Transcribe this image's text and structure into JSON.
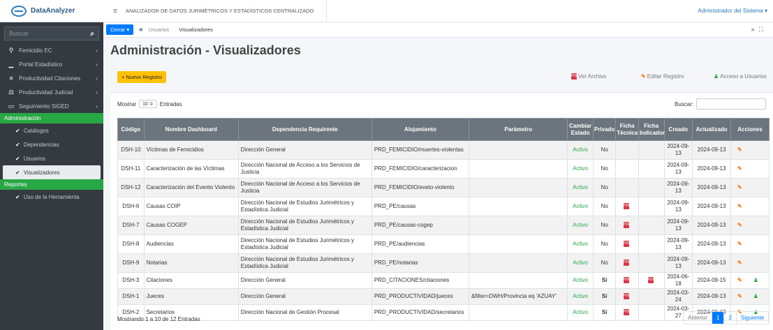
{
  "brand": {
    "name": "DataAnalyzer"
  },
  "sidebar": {
    "search_placeholder": "Buscar",
    "items": [
      {
        "label": "Femicidio EC"
      },
      {
        "label": "Portal Estadístico"
      },
      {
        "label": "Productividad Citaciones"
      },
      {
        "label": "Productividad Judicial"
      },
      {
        "label": "Seguimiento SIGED"
      }
    ],
    "section_admin": "Administración",
    "admin_items": [
      {
        "label": "Catálogos"
      },
      {
        "label": "Dependencias"
      },
      {
        "label": "Usuarios"
      },
      {
        "label": "Visualizadores"
      }
    ],
    "section_reports": "Reportes",
    "report_items": [
      {
        "label": "Uso de la Herramienta"
      }
    ]
  },
  "topbar": {
    "title": "ANALIZADOR DE DATOS JURIMÉTRICOS Y ESTADÍSTICOS CENTRALIZADO",
    "user": "Administrador del Sistema ▾"
  },
  "subbar": {
    "close_label": "Cerrar ▾",
    "crumbs": [
      "Usuarios",
      "Visualizadores"
    ]
  },
  "page": {
    "title": "Administración - Visualizadores"
  },
  "toolbar": {
    "new_label": "Nuevo Registro",
    "view_file": "Ver Archivo",
    "edit": "Editar Registro",
    "access": "Acceso a Usuarios"
  },
  "table_controls": {
    "show": "Mostrar",
    "show_value": "10 ≑",
    "entries": "Entradas",
    "search": "Buscar:"
  },
  "table": {
    "headers": [
      "Código",
      "Nombre Dashboard",
      "Dependencia Requirente",
      "Alojamiento",
      "Parámetro",
      "Cambiar Estado",
      "Privado",
      "Ficha Técnica",
      "Ficha Indicador",
      "Creado",
      "Actualizado",
      "Acciones"
    ],
    "rows": [
      {
        "code": "DSH-10",
        "name": "Víctimas de Femicidios",
        "dep": "Dirección General",
        "host": "PRD_FEMICIDIO/muertes-violentas",
        "param": "",
        "estado": "Activo",
        "priv": "No",
        "ft": false,
        "fi": false,
        "created": "2024-09-13",
        "updated": "2024-09-13",
        "user": false
      },
      {
        "code": "DSH-11",
        "name": "Caracterización de las Víctimas",
        "dep": "Dirección Nacional de Acceso a los Servicios de Justicia",
        "host": "PRD_FEMICIDIO/caracterizacion",
        "param": "",
        "estado": "Activo",
        "priv": "No",
        "ft": false,
        "fi": false,
        "created": "2024-09-13",
        "updated": "2024-09-13",
        "user": false
      },
      {
        "code": "DSH-12",
        "name": "Caracterización del Evento Violento",
        "dep": "Dirección Nacional de Acceso a los Servicios de Justicia",
        "host": "PRD_FEMICIDIO/eveto-violento",
        "param": "",
        "estado": "Activo",
        "priv": "No",
        "ft": false,
        "fi": false,
        "created": "2024-09-13",
        "updated": "2024-09-13",
        "user": false
      },
      {
        "code": "DSH-6",
        "name": "Causas COIP",
        "dep": "Dirección Nacional de Estudios Jurimétricos y Estadística Judicial",
        "host": "PRD_PE/causas",
        "param": "",
        "estado": "Activo",
        "priv": "No",
        "ft": true,
        "fi": false,
        "created": "2024-09-13",
        "updated": "2024-09-13",
        "user": false
      },
      {
        "code": "DSH-7",
        "name": "Causas COGEP",
        "dep": "Dirección Nacional de Estudios Jurimétricos y Estadística Judicial",
        "host": "PRD_PE/causas-cogep",
        "param": "",
        "estado": "Activo",
        "priv": "No",
        "ft": true,
        "fi": false,
        "created": "2024-09-13",
        "updated": "2024-09-13",
        "user": false
      },
      {
        "code": "DSH-8",
        "name": "Audiencias",
        "dep": "Dirección Nacional de Estudios Jurimétricos y Estadística Judicial",
        "host": "PRD_PE/audiencias",
        "param": "",
        "estado": "Activo",
        "priv": "No",
        "ft": true,
        "fi": false,
        "created": "2024-09-13",
        "updated": "2024-09-13",
        "user": false
      },
      {
        "code": "DSH-9",
        "name": "Notarias",
        "dep": "Dirección Nacional de Estudios Jurimétricos y Estadística Judicial",
        "host": "PRD_PE/notarias",
        "param": "",
        "estado": "Activo",
        "priv": "No",
        "ft": true,
        "fi": false,
        "created": "2024-09-13",
        "updated": "2024-09-13",
        "user": false
      },
      {
        "code": "DSH-3",
        "name": "Citaciones",
        "dep": "Dirección General",
        "host": "PRD_CITACIONES/citaciones",
        "param": "",
        "estado": "Activo",
        "priv": "Si",
        "ft": true,
        "fi": true,
        "created": "2024-06-18",
        "updated": "2024-09-15",
        "user": true
      },
      {
        "code": "DSH-1",
        "name": "Jueces",
        "dep": "Dirección General",
        "host": "PRD_PRODUCTIVIDAD/jueces",
        "param": "&filter=DWH/Provincia eq 'AZUAY'",
        "estado": "Activo",
        "priv": "Si",
        "ft": true,
        "fi": false,
        "created": "2024-03-24",
        "updated": "2024-09-13",
        "user": true
      },
      {
        "code": "DSH-2",
        "name": "Secretarios",
        "dep": "Dirección Nacional de Gestión Procesal",
        "host": "PRD_PRODUCTIVIDAD/secretarios",
        "param": "",
        "estado": "Activo",
        "priv": "Si",
        "ft": true,
        "fi": false,
        "created": "2024-03-27",
        "updated": "2024-09-13",
        "user": true
      }
    ]
  },
  "footer": {
    "info": "Mostrando 1 a 10 de 12 Entradas",
    "prev": "Anterior",
    "pages": [
      "1",
      "2"
    ],
    "next": "Siguiente"
  },
  "icons": {
    "pdf": "pdf-icon",
    "edit": "edit-icon",
    "users": "users-icon"
  },
  "colors": {
    "green": "#28a745",
    "blue": "#007bff",
    "yellow": "#ffc107",
    "dark": "#343a40",
    "header": "#6c757d"
  }
}
